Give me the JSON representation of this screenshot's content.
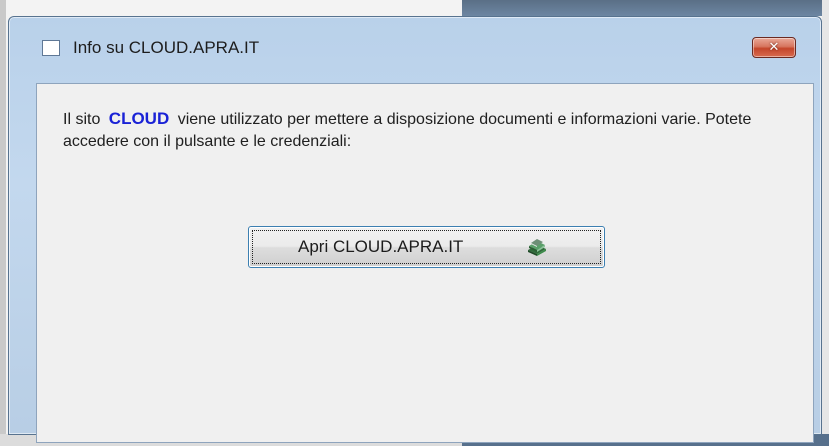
{
  "window": {
    "title": "Info su CLOUD.APRA.IT",
    "close_symbol": "✕"
  },
  "message": {
    "prefix": "Il sito",
    "brand": "CLOUD",
    "suffix": "viene utilizzato per mettere a disposizione documenti e informazioni varie. Potete accedere con il pulsante e le credenziali:"
  },
  "button": {
    "label": "Apri CLOUD.APRA.IT",
    "icon": "book-stack-icon"
  },
  "colors": {
    "brand_text": "#1a22d6",
    "close_button": "#c4462b",
    "title_bar": "#b9d1ea"
  }
}
